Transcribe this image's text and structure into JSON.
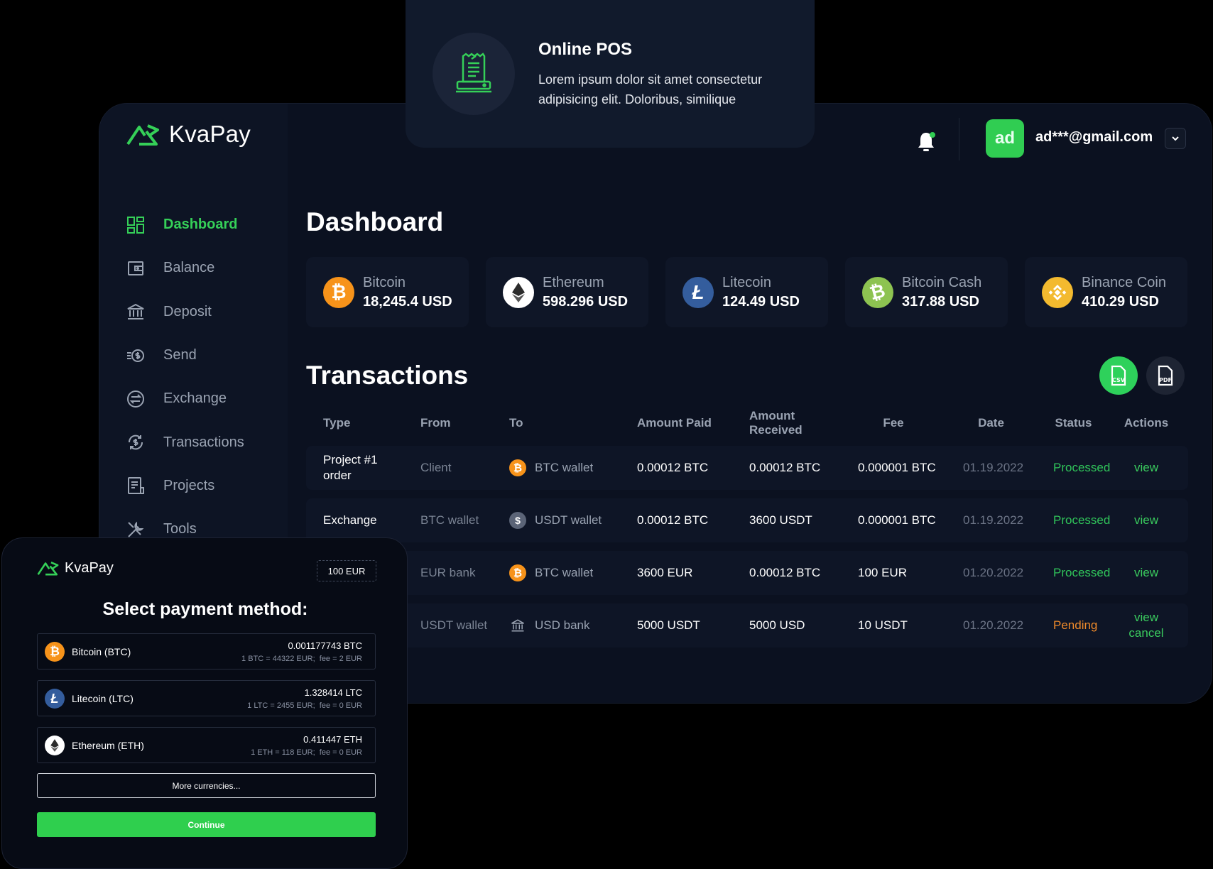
{
  "brand": {
    "name": "KvaPay",
    "accent": "#35d058"
  },
  "sidebar": {
    "items": [
      {
        "label": "Dashboard",
        "icon": "dashboard-grid-icon",
        "active": true
      },
      {
        "label": "Balance",
        "icon": "wallet-icon"
      },
      {
        "label": "Deposit",
        "icon": "bank-icon"
      },
      {
        "label": "Send",
        "icon": "send-dollar-icon"
      },
      {
        "label": "Exchange",
        "icon": "exchange-icon"
      },
      {
        "label": "Transactions",
        "icon": "transactions-icon"
      },
      {
        "label": "Projects",
        "icon": "projects-icon"
      },
      {
        "label": "Tools",
        "icon": "tools-icon"
      }
    ]
  },
  "header": {
    "avatar_initials": "ad",
    "user_email": "ad***@gmail.com",
    "notification_icon": "bell-icon"
  },
  "dashboard": {
    "title": "Dashboard",
    "coins": [
      {
        "name": "Bitcoin",
        "value": "18,245.4 USD",
        "icon": "bitcoin-icon",
        "color": "#f7931a"
      },
      {
        "name": "Ethereum",
        "value": "598.296 USD",
        "icon": "ethereum-icon",
        "color": "#ffffff"
      },
      {
        "name": "Litecoin",
        "value": "124.49 USD",
        "icon": "litecoin-icon",
        "color": "#345d9d"
      },
      {
        "name": "Bitcoin Cash",
        "value": "317.88 USD",
        "icon": "bitcoin-cash-icon",
        "color": "#8dc351"
      },
      {
        "name": "Binance Coin",
        "value": "410.29 USD",
        "icon": "binance-coin-icon",
        "color": "#f3ba2f"
      }
    ]
  },
  "transactions": {
    "title": "Transactions",
    "export_csv_icon": "csv-file-icon",
    "export_pdf_icon": "pdf-file-icon",
    "columns": [
      "Type",
      "From",
      "To",
      "Amount Paid",
      "Amount Received",
      "Fee",
      "Date",
      "Status",
      "Actions"
    ],
    "rows": [
      {
        "type": "Project #1 order",
        "from": "Client",
        "to": "BTC wallet",
        "to_icon": "bitcoin-icon",
        "paid": "0.00012 BTC",
        "received": "0.00012 BTC",
        "fee": "0.000001 BTC",
        "date": "01.19.2022",
        "status": "Processed",
        "action1": "view",
        "action2": ""
      },
      {
        "type": "Exchange",
        "from": "BTC wallet",
        "to": "USDT wallet",
        "to_icon": "usdt-icon",
        "paid": "0.00012 BTC",
        "received": "3600 USDT",
        "fee": "0.000001 BTC",
        "date": "01.19.2022",
        "status": "Processed",
        "action1": "view",
        "action2": ""
      },
      {
        "type": "",
        "from": "EUR bank",
        "to": "BTC wallet",
        "to_icon": "bitcoin-icon",
        "paid": "3600 EUR",
        "received": "0.00012 BTC",
        "fee": "100 EUR",
        "date": "01.20.2022",
        "status": "Processed",
        "action1": "view",
        "action2": ""
      },
      {
        "type": "",
        "from": "USDT wallet",
        "to": "USD bank",
        "to_icon": "bank-icon",
        "paid": "5000 USDT",
        "received": "5000 USD",
        "fee": "10 USDT",
        "date": "01.20.2022",
        "status": "Pending",
        "action1": "view",
        "action2": "cancel"
      }
    ],
    "status_colors": {
      "Processed": "#30c55a",
      "Pending": "#ef8a2a"
    }
  },
  "pos": {
    "title": "Online POS",
    "description": "Lorem ipsum dolor sit amet consectetur adipisicing elit. Doloribus, similique",
    "icon": "pos-terminal-icon"
  },
  "payment_widget": {
    "brand": "KvaPay",
    "amount": "100 EUR",
    "title": "Select payment method:",
    "options": [
      {
        "name": "Bitcoin (BTC)",
        "amount": "0.001177743 BTC",
        "rate": "1 BTC = 44322 EUR;  fee = 2 EUR",
        "icon": "bitcoin-icon"
      },
      {
        "name": "Litecoin (LTC)",
        "amount": "1.328414 LTC",
        "rate": "1 LTC = 2455 EUR;  fee = 0 EUR",
        "icon": "litecoin-icon"
      },
      {
        "name": "Ethereum (ETH)",
        "amount": "0.411447 ETH",
        "rate": "1 ETH = 118 EUR;  fee = 0 EUR",
        "icon": "ethereum-icon"
      }
    ],
    "more_label": "More currencies...",
    "continue_label": "Continue"
  }
}
